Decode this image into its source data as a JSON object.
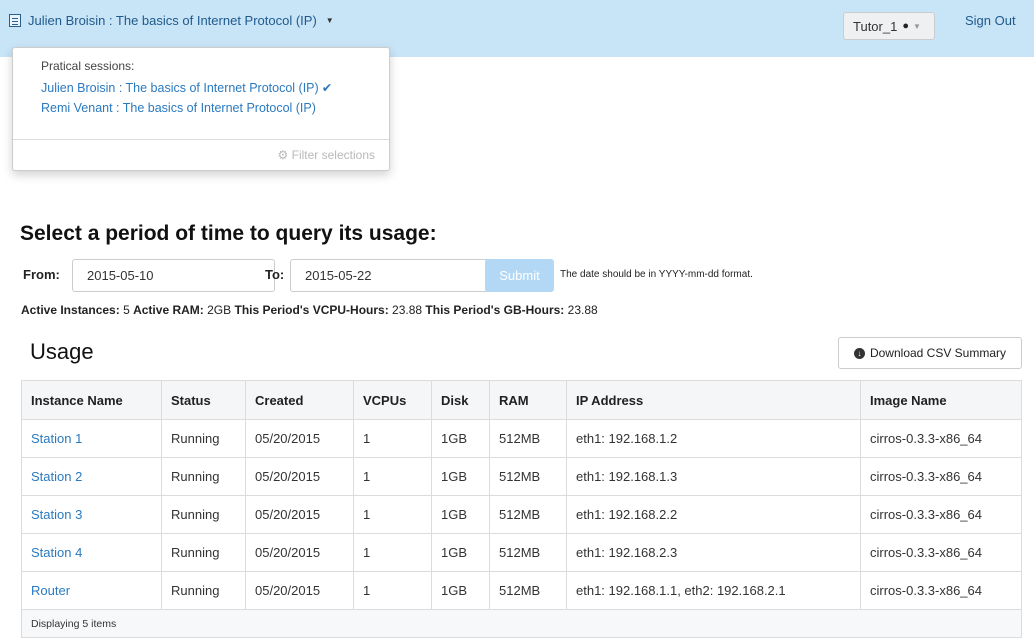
{
  "topbar": {
    "project_label": "Julien Broisin : The basics of Internet Protocol (IP)",
    "user_label": "Tutor_1",
    "signout_label": "Sign Out"
  },
  "dropdown": {
    "header": "Pratical sessions:",
    "options": [
      {
        "label": "Julien Broisin : The basics of Internet Protocol (IP)",
        "selected": true
      },
      {
        "label": "Remi Venant : The basics of Internet Protocol (IP)",
        "selected": false
      }
    ],
    "filter_label": "Filter selections"
  },
  "period": {
    "title": "Select a period of time to query its usage:",
    "from_label": "From:",
    "from_value": "2015-05-10",
    "to_label": "To:",
    "to_value": "2015-05-22",
    "submit_label": "Submit",
    "hint": "The date should be in YYYY-mm-dd format."
  },
  "summary": {
    "active_instances_label": "Active Instances:",
    "active_instances": "5",
    "active_ram_label": "Active RAM:",
    "active_ram": "2GB",
    "vcpu_hours_label": "This Period's VCPU-Hours:",
    "vcpu_hours": "23.88",
    "gb_hours_label": "This Period's GB-Hours:",
    "gb_hours": "23.88"
  },
  "usage": {
    "title": "Usage",
    "csv_button": "Download CSV Summary",
    "columns": [
      "Instance Name",
      "Status",
      "Created",
      "VCPUs",
      "Disk",
      "RAM",
      "IP Address",
      "Image Name"
    ],
    "rows": [
      [
        "Station 1",
        "Running",
        "05/20/2015",
        "1",
        "1GB",
        "512MB",
        "eth1: 192.168.1.2",
        "cirros-0.3.3-x86_64"
      ],
      [
        "Station 2",
        "Running",
        "05/20/2015",
        "1",
        "1GB",
        "512MB",
        "eth1: 192.168.1.3",
        "cirros-0.3.3-x86_64"
      ],
      [
        "Station 3",
        "Running",
        "05/20/2015",
        "1",
        "1GB",
        "512MB",
        "eth1: 192.168.2.2",
        "cirros-0.3.3-x86_64"
      ],
      [
        "Station 4",
        "Running",
        "05/20/2015",
        "1",
        "1GB",
        "512MB",
        "eth1: 192.168.2.3",
        "cirros-0.3.3-x86_64"
      ],
      [
        "Router",
        "Running",
        "05/20/2015",
        "1",
        "1GB",
        "512MB",
        "eth1: 192.168.1.1, eth2: 192.168.2.1",
        "cirros-0.3.3-x86_64"
      ]
    ],
    "footer": "Displaying 5 items"
  },
  "colors": {
    "topbar_bg": "#c8e4f7",
    "link": "#2a7ac0",
    "submit_bg": "#b3d8f5"
  }
}
